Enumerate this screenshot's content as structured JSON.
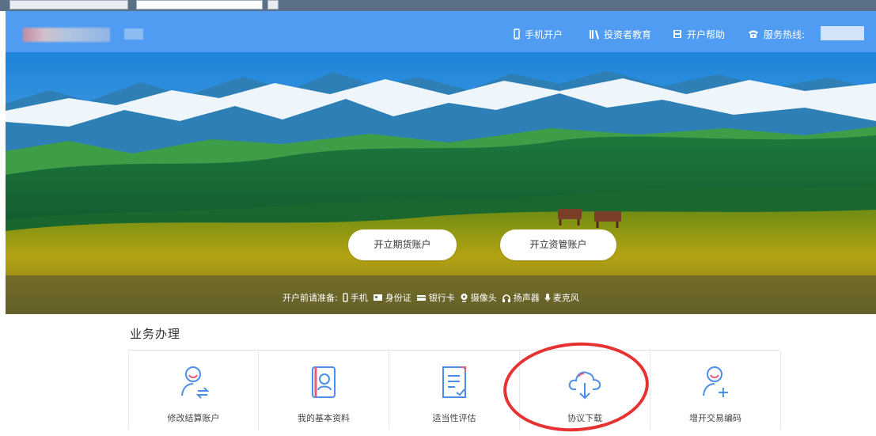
{
  "header": {
    "nav_mobile": "手机开户",
    "nav_education": "投资者教育",
    "nav_help": "开户帮助",
    "nav_hotline": "服务热线:"
  },
  "banner": {
    "button_futures": "开立期货账户",
    "button_asset": "开立资管账户",
    "requirements_label": "开户前请准备:",
    "requirements": [
      "手机",
      "身份证",
      "银行卡",
      "摄像头",
      "扬声器",
      "麦克风"
    ]
  },
  "services": {
    "title": "业务办理",
    "items": [
      {
        "label": "修改结算账户",
        "icon": "user-switch-icon"
      },
      {
        "label": "我的基本资料",
        "icon": "profile-book-icon"
      },
      {
        "label": "适当性评估",
        "icon": "assessment-icon"
      },
      {
        "label": "协议下载",
        "icon": "cloud-download-icon"
      },
      {
        "label": "增开交易编码",
        "icon": "user-add-icon"
      }
    ]
  },
  "colors": {
    "header": "#4f9cf2",
    "accent": "#4b8ee8",
    "highlight": "#e73232"
  }
}
